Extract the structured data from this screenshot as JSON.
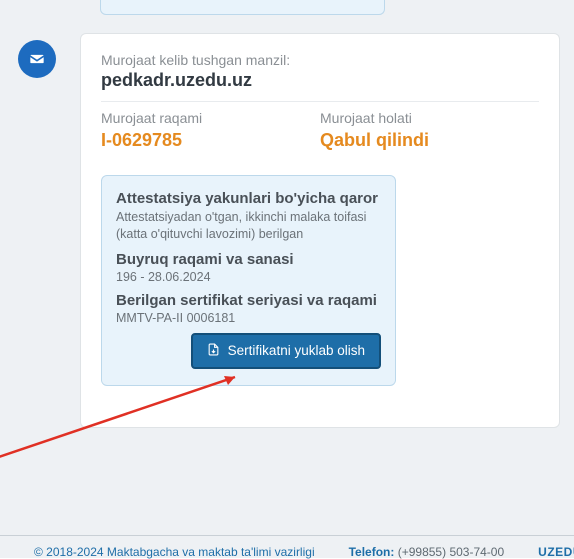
{
  "card": {
    "source_label": "Murojaat kelib tushgan manzil:",
    "address": "pedkadr.uzedu.uz",
    "number_label": "Murojaat raqami",
    "number_value": "I-0629785",
    "status_label": "Murojaat holati",
    "status_value": "Qabul qilindi"
  },
  "result": {
    "decision_title": "Attestatsiya yakunlari bo'yicha qaror",
    "decision_text": "Attestatsiyadan o'tgan, ikkinchi malaka toifasi (katta o'qituvchi lavozimi) berilgan",
    "order_title": "Buyruq raqami va sanasi",
    "order_value": "196 - 28.06.2024",
    "cert_title": "Berilgan sertifikat seriyasi va raqami",
    "cert_value": "MMTV-PA-II 0006181",
    "download_label": "Sertifikatni yuklab olish"
  },
  "footer": {
    "copyright": "© 2018-2024 Maktabgacha va maktab ta'limi vazirligi",
    "tel_label": "Telefon:",
    "tel_number": "(+99855) 503-74-00",
    "brand": "UZEDU.U"
  },
  "icons": {
    "avatar": "mailbox-icon",
    "download": "file-download-icon"
  },
  "colors": {
    "accent_orange": "#e58a1f",
    "accent_blue": "#1e6ea8",
    "annotation_red": "#e03024"
  }
}
